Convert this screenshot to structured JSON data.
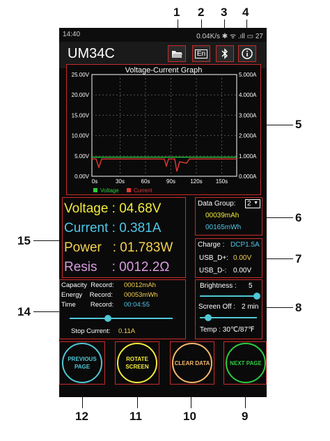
{
  "status_bar": {
    "time": "14:40",
    "right": "0.04K/s ✱ ᯤ .ıll ▭ 27"
  },
  "app": {
    "title": "UM34C"
  },
  "icons": {
    "open_folder": "folder-open-icon",
    "language": "En",
    "bluetooth": "bluetooth-icon",
    "info": "info-icon"
  },
  "graph": {
    "title": "Voltage-Current Graph",
    "left_ticks": [
      "25.00V",
      "20.00V",
      "15.00V",
      "10.00V",
      "5.00V",
      "0.00V"
    ],
    "right_ticks": [
      "5.000A",
      "4.000A",
      "3.000A",
      "2.000A",
      "1.000A",
      "0.000A"
    ],
    "x_ticks": [
      "0s",
      "30s",
      "60s",
      "90s",
      "120s",
      "150s"
    ],
    "legend_voltage": "Voltage",
    "legend_current": "Current",
    "voltage_color": "#2ecc40",
    "current_color": "#e53935"
  },
  "readings": {
    "voltage": "Voltage : 04.68V",
    "current": "Current : 0.381A",
    "power": "Power   : 01.783W",
    "resis": "Resis    : 0012.2Ω",
    "colors": {
      "voltage": "#f2ea3c",
      "current": "#4fc7e8",
      "power": "#f4d050",
      "resis": "#d89be0"
    }
  },
  "data_group": {
    "label": "Data Group:",
    "selected": "2",
    "mah": "00039mAh",
    "mwh": "00165mWh"
  },
  "charge": {
    "label": "Charge :",
    "mode": "DCP1.5A",
    "usb_dp_label": "USB_D+:",
    "usb_dp": "0.00V",
    "usb_dm_label": "USB_D-:",
    "usb_dm": "0.00V"
  },
  "record": {
    "cap_label": "Capacity  Record:",
    "cap_val": "00012mAh",
    "energy_label": "Energy    Record:",
    "energy_val": "00053mWh",
    "time_label": "Time        Record:",
    "time_val": "00:04:55",
    "stop_label": "Stop Current:",
    "stop_val": "0.11A",
    "stop_slider_fraction": 0.37
  },
  "settings": {
    "brightness_label": "Brightness :",
    "brightness": "5",
    "brightness_fraction": 1.0,
    "screen_off_label": "Screen Off :",
    "screen_off": "2 min",
    "screen_off_fraction": 0.15,
    "temp": "Temp :  30℃/87℉"
  },
  "buttons": {
    "prev": "PREVIOUS PAGE",
    "rotate": "ROTATE SCREEN",
    "clear": "CLEAR DATA",
    "next": "NEXT PAGE"
  },
  "callouts": [
    "1",
    "2",
    "3",
    "4",
    "5",
    "6",
    "7",
    "8",
    "9",
    "10",
    "11",
    "12",
    "14",
    "15"
  ]
}
